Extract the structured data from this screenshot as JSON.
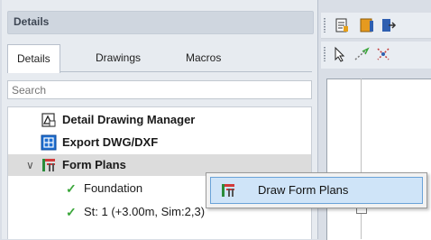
{
  "panel": {
    "title": "Details"
  },
  "tabs": [
    {
      "label": "Details",
      "active": true
    },
    {
      "label": "Drawings",
      "active": false
    },
    {
      "label": "Macros",
      "active": false
    }
  ],
  "search": {
    "placeholder": "Search"
  },
  "tree": {
    "items": [
      {
        "label": "Detail Drawing Manager",
        "icon": "drawing-manager-icon"
      },
      {
        "label": "Export DWG/DXF",
        "icon": "export-dwg-icon"
      },
      {
        "label": "Form Plans",
        "icon": "form-plans-icon",
        "expanded": true,
        "selected": true
      },
      {
        "label": "Foundation",
        "icon": "check-icon"
      },
      {
        "label": "St: 1 (+3.00m, Sim:2,3)",
        "icon": "check-icon"
      }
    ]
  },
  "context_menu": {
    "items": [
      {
        "label": "Draw Form Plans",
        "icon": "form-plans-icon"
      }
    ]
  },
  "colors": {
    "accent": "#6aa3d8",
    "check": "#3aa63a",
    "highlight": "#cfe4f8"
  }
}
